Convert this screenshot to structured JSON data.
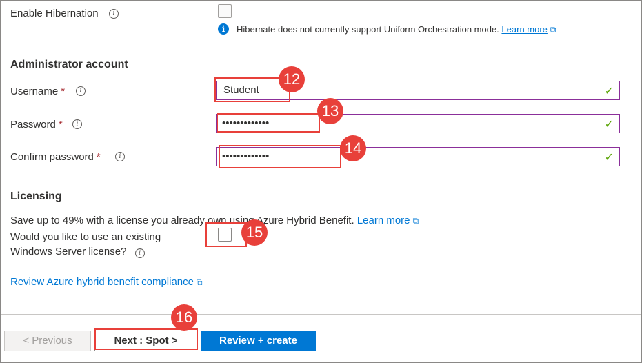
{
  "hibernation": {
    "label": "Enable Hibernation",
    "note": "Hibernate does not currently support Uniform Orchestration mode.",
    "learn_more": "Learn more"
  },
  "admin": {
    "title": "Administrator account",
    "username_label": "Username",
    "username_value": "Student",
    "password_label": "Password",
    "password_value": "•••••••••••••",
    "confirm_label": "Confirm password",
    "confirm_value": "•••••••••••••",
    "required_mark": "*"
  },
  "licensing": {
    "title": "Licensing",
    "description": "Save up to 49% with a license you already own using Azure Hybrid Benefit.",
    "learn_more": "Learn more",
    "question_line1": "Would you like to use an existing",
    "question_line2": "Windows Server license?",
    "compliance_link": "Review Azure hybrid benefit compliance"
  },
  "footer": {
    "previous": "< Previous",
    "next": "Next : Spot >",
    "review": "Review + create"
  },
  "callouts": {
    "c12": "12",
    "c13": "13",
    "c14": "14",
    "c15": "15",
    "c16": "16"
  },
  "icons": {
    "info": "i",
    "check": "✓",
    "external": "⧉"
  },
  "colors": {
    "accent_blue": "#0078d4",
    "annotation_red": "#e8403a",
    "valid_green": "#57a300",
    "field_border": "#8b2f9a"
  }
}
